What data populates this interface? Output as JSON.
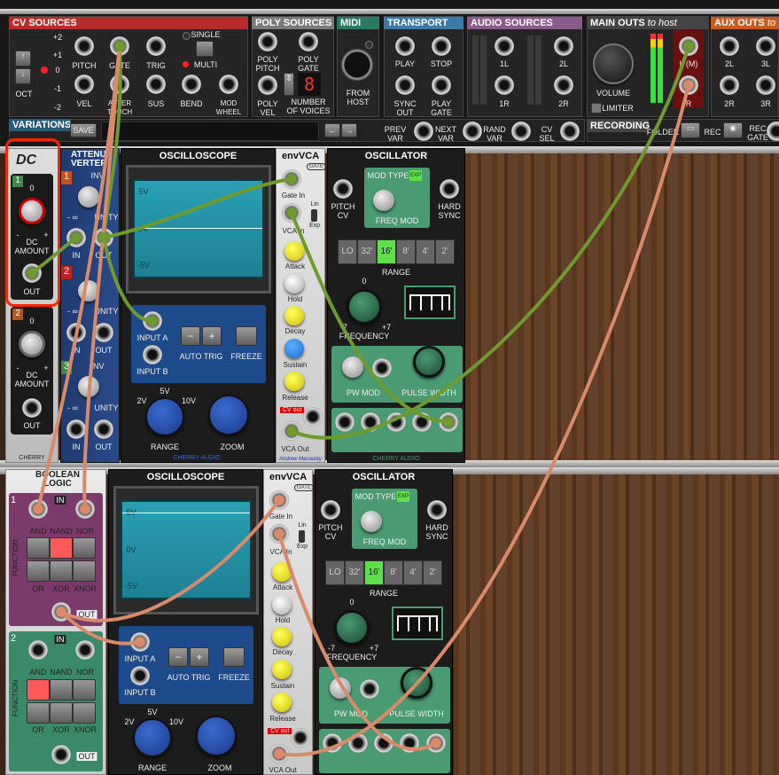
{
  "top": {
    "cv_sources": {
      "title": "CV SOURCES",
      "octaves": [
        "+2",
        "+1",
        "0",
        "-1",
        "-2"
      ],
      "oct_label": "OCT",
      "jacks": [
        "PITCH",
        "GATE",
        "TRIG",
        "VEL",
        "AFTER TOUCH",
        "SUS",
        "BEND",
        "MOD WHEEL"
      ],
      "single": "SINGLE",
      "multi": "MULTI"
    },
    "poly_sources": {
      "title": "POLY SOURCES",
      "jacks": [
        "POLY PITCH",
        "POLY GATE",
        "POLY VEL"
      ],
      "voices_label": "NUMBER OF VOICES",
      "voices_value": "8"
    },
    "midi": {
      "title": "MIDI",
      "from_host": "FROM HOST"
    },
    "transport": {
      "title": "TRANSPORT",
      "jacks": [
        "PLAY",
        "STOP",
        "SYNC OUT",
        "PLAY GATE"
      ]
    },
    "audio_sources": {
      "title": "AUDIO SOURCES",
      "jacks": [
        "1L",
        "2L",
        "1R",
        "2R"
      ]
    },
    "main_outs": {
      "title": "MAIN OUTS",
      "title_suffix": "to host",
      "volume": "VOLUME",
      "limiter": "LIMITER",
      "jacks": [
        "L (M)",
        "R"
      ]
    },
    "aux_outs": {
      "title": "AUX OUTS",
      "title_suffix": "to ho",
      "jacks": [
        "2L",
        "3L",
        "2R",
        "3R"
      ]
    },
    "variations": {
      "title": "VARIATIONS",
      "save": "SAVE",
      "prev": "PREV VAR",
      "next": "NEXT VAR",
      "rand": "RAND VAR",
      "cvsel": "CV SEL"
    },
    "recording": {
      "title": "RECORDING",
      "folder": "FOLDER",
      "rec": "REC",
      "rec_gate": "REC GATE"
    }
  },
  "dc_module": {
    "logo": "DC",
    "badge1": "1",
    "badge2": "2",
    "zero": "0",
    "minus": "-",
    "plus": "+",
    "amount": "DC AMOUNT",
    "out": "OUT",
    "brand": "CHERRY"
  },
  "attenuverter": {
    "title": "ATTENU VERTER",
    "badges": [
      "1",
      "2",
      "3"
    ],
    "inv": "INV",
    "unity": "UNITY",
    "minf": "- ∞",
    "in": "IN",
    "out": "OUT"
  },
  "scope1": {
    "title": "OSCILLOSCOPE",
    "ticks": [
      "5V",
      "0V",
      "-5V"
    ],
    "input_a": "INPUT A",
    "input_b": "INPUT B",
    "auto_trig": "AUTO TRIG",
    "freeze": "FREEZE",
    "range_vals": [
      "2V",
      "5V",
      "10V"
    ],
    "range": "RANGE",
    "zoom": "ZOOM",
    "brand": "CHERRY AUDIO"
  },
  "scope2": {
    "title": "OSCILLOSCOPE",
    "ticks": [
      "5V",
      "0V",
      "-5V"
    ],
    "input_a": "INPUT A",
    "input_b": "INPUT B",
    "auto_trig": "AUTO TRIG",
    "freeze": "FREEZE",
    "range_vals": [
      "2V",
      "5V",
      "10V"
    ],
    "range": "RANGE",
    "zoom": "ZOOM"
  },
  "envvca1": {
    "title": "envVCA",
    "gate_tag": "GATE",
    "gate_in": "Gate In",
    "vca_in": "VCA In",
    "lin": "Lin",
    "exp": "Exp",
    "attack": "Attack",
    "hold": "Hold",
    "decay": "Decay",
    "sustain": "Sustain",
    "release": "Release",
    "cv_out": "CV out",
    "vca_out": "VCA Out",
    "author": "Andrew Macaulay"
  },
  "envvca2": {
    "title": "envVCA",
    "gate_tag": "GATE",
    "gate_in": "Gate In",
    "vca_in": "VCA In",
    "lin": "Lin",
    "exp": "Exp",
    "attack": "Attack",
    "hold": "Hold",
    "decay": "Decay",
    "sustain": "Sustain",
    "release": "Release",
    "cv_out": "CV out",
    "vca_out": "VCA Out"
  },
  "osc1": {
    "title": "OSCILLATOR",
    "mod_type": "MOD TYPE",
    "exp": "EXP",
    "pitch_cv": "PITCH CV",
    "freq_mod": "FREQ MOD",
    "hard_sync": "HARD SYNC",
    "ranges": [
      "LO",
      "32'",
      "16'",
      "8'",
      "4'",
      "2'"
    ],
    "selected_range": "16'",
    "range": "RANGE",
    "freq_zero": "0",
    "freq_min": "-7",
    "freq_max": "+7",
    "frequency": "FREQUENCY",
    "pw_mod": "PW MOD",
    "pulse_width": "PULSE WIDTH",
    "brand": "CHERRY AUDIO"
  },
  "osc2": {
    "title": "OSCILLATOR",
    "mod_type": "MOD TYPE",
    "exp": "EXP",
    "pitch_cv": "PITCH CV",
    "freq_mod": "FREQ MOD",
    "hard_sync": "HARD SYNC",
    "ranges": [
      "LO",
      "32'",
      "16'",
      "8'",
      "4'",
      "2'"
    ],
    "selected_range": "16'",
    "range": "RANGE",
    "freq_zero": "0",
    "freq_min": "-7",
    "freq_max": "+7",
    "frequency": "FREQUENCY",
    "pw_mod": "PW MOD",
    "pulse_width": "PULSE WIDTH"
  },
  "boolean": {
    "title": "BOOLEAN LOGIC",
    "badges": [
      "1",
      "2"
    ],
    "in": "IN",
    "function": "FUNCTION",
    "gates_top": [
      "AND",
      "NAND",
      "NOR"
    ],
    "gates_bottom": [
      "OR",
      "XOR",
      "XNOR"
    ],
    "out": "OUT"
  },
  "colors": {
    "green_cable": "#6f9a2e",
    "orange_cable": "#d88a6a",
    "highlight": "#ff2200",
    "cv_header": "#b82b2b",
    "poly_header": "#7a7a7a",
    "midi_header": "#2a7a62",
    "transport_header": "#3a7aa8",
    "audio_header": "#8a5a8a"
  }
}
